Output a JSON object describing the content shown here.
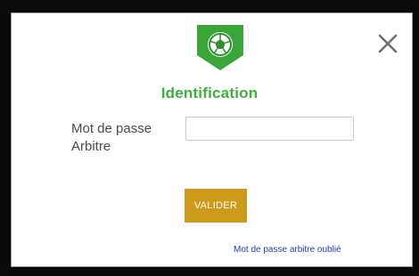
{
  "dialog": {
    "title": "Identification",
    "logo_icon": "soccer-ball-icon",
    "close_icon": "close-icon",
    "accent_color": "#3fae3f",
    "button_color": "#cc9a1d",
    "link_color": "#2a3aa8"
  },
  "form": {
    "password_label": "Mot de passe Arbitre",
    "password_value": "",
    "password_placeholder": "",
    "submit_label": "VALIDER",
    "forgot_link_label": "Mot de passe arbitre oublié"
  }
}
